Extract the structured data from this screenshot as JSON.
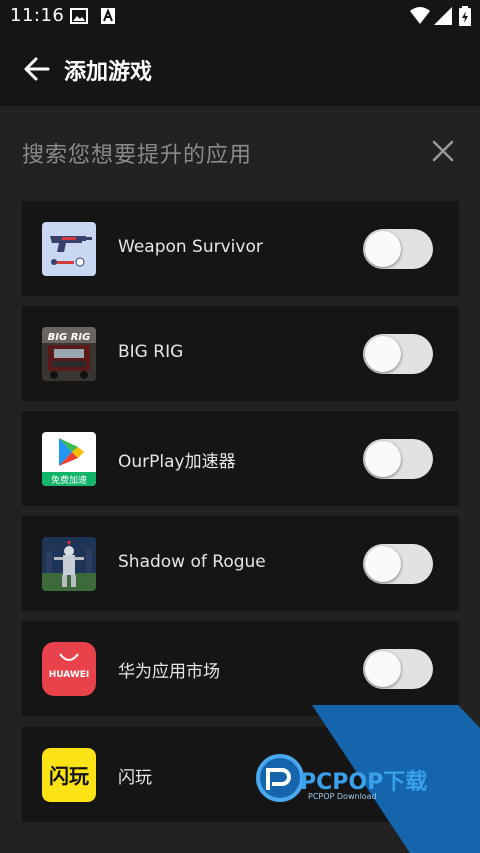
{
  "status_bar": {
    "time": "11:16"
  },
  "header": {
    "title": "添加游戏",
    "back_icon": "arrow-left-icon"
  },
  "search": {
    "placeholder": "搜索您想要提升的应用",
    "clear_icon": "close-icon"
  },
  "apps": [
    {
      "name": "Weapon Survivor",
      "enabled": false,
      "icon": "weapon-survivor-icon"
    },
    {
      "name": "BIG RIG",
      "enabled": false,
      "icon": "big-rig-icon",
      "icon_text": "BIG RIG"
    },
    {
      "name": "OurPlay加速器",
      "enabled": false,
      "icon": "ourplay-icon",
      "icon_text": "免费加速"
    },
    {
      "name": "Shadow of Rogue",
      "enabled": false,
      "icon": "shadow-of-rogue-icon"
    },
    {
      "name": "华为应用市场",
      "enabled": false,
      "icon": "huawei-appgallery-icon",
      "icon_text": "HUAWEI"
    },
    {
      "name": "闪玩",
      "enabled": false,
      "icon": "shanwan-icon",
      "icon_text": "闪玩"
    }
  ],
  "watermark": {
    "text": "PCPOP下载",
    "sub": "PCPOP Download"
  },
  "colors": {
    "background": "#222222",
    "card": "#151515",
    "toggle_off": "#e2e2e2",
    "huawei_red": "#e8424a",
    "shanwan_yellow": "#fbe315",
    "watermark_blue": "#1565ad"
  }
}
